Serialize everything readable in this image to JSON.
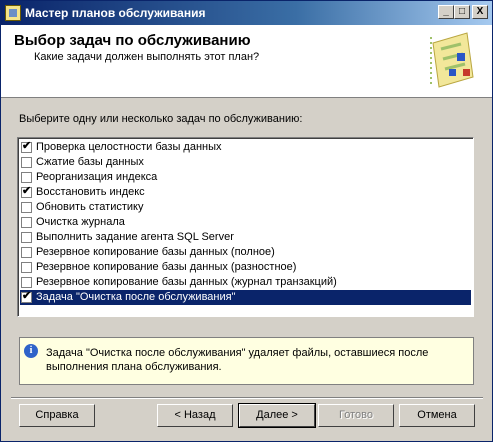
{
  "window": {
    "title": "Мастер планов обслуживания",
    "controls": {
      "minimize": "_",
      "maximize": "□",
      "close": "X"
    }
  },
  "header": {
    "title": "Выбор задач по обслуживанию",
    "subtitle": "Какие задачи должен выполнять этот план?",
    "image_icon": "wizard-plan-icon"
  },
  "prompt": "Выберите одну или несколько задач по обслуживанию:",
  "tasks": [
    {
      "label": "Проверка целостности базы данных",
      "checked": true
    },
    {
      "label": "Сжатие базы данных",
      "checked": false
    },
    {
      "label": "Реорганизация индекса",
      "checked": false
    },
    {
      "label": "Восстановить индекс",
      "checked": true
    },
    {
      "label": "Обновить статистику",
      "checked": false
    },
    {
      "label": "Очистка журнала",
      "checked": false
    },
    {
      "label": "Выполнить задание агента SQL Server",
      "checked": false
    },
    {
      "label": "Резервное копирование базы данных (полное)",
      "checked": false
    },
    {
      "label": "Резервное копирование базы данных (разностное)",
      "checked": false
    },
    {
      "label": "Резервное копирование базы данных (журнал транзакций)",
      "checked": false
    },
    {
      "label": "Задача \"Очистка после обслуживания\"",
      "checked": true,
      "selected": true
    }
  ],
  "check_mark": "✔",
  "info": {
    "icon": "info-icon",
    "icon_glyph": "i",
    "text": "Задача \"Очистка после обслуживания\" удаляет файлы, оставшиеся после выполнения плана обслуживания."
  },
  "buttons": {
    "help": "Справка",
    "back": "< Назад",
    "next": "Далее >",
    "finish": "Готово",
    "cancel": "Отмена"
  }
}
